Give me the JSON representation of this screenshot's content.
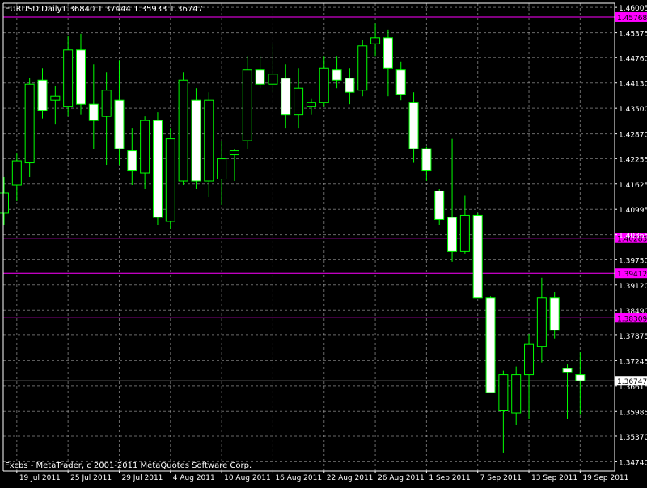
{
  "chart_data": {
    "type": "candlestick",
    "header": {
      "symbol_label": "EURUSD,Daily",
      "ohlc_text": "1.36840 1.37444 1.35933 1.36747"
    },
    "copyright": "Fxcbs - MetaTrader, c 2001-2011 MetaQuotes Software Corp.",
    "ylim": [
      1.34568,
      1.46128
    ],
    "y_ticks": [
      "1.46005",
      "1.45375",
      "1.44760",
      "1.44130",
      "1.43500",
      "1.42870",
      "1.42255",
      "1.41625",
      "1.40995",
      "1.40365",
      "1.39750",
      "1.39120",
      "1.38490",
      "1.37875",
      "1.37245",
      "1.36615",
      "1.35985",
      "1.35370",
      "1.34740"
    ],
    "x_ticks": [
      {
        "label": "19 Jul 2011",
        "bar": 1
      },
      {
        "label": "25 Jul 2011",
        "bar": 5
      },
      {
        "label": "29 Jul 2011",
        "bar": 9
      },
      {
        "label": "4 Aug 2011",
        "bar": 13
      },
      {
        "label": "10 Aug 2011",
        "bar": 17
      },
      {
        "label": "16 Aug 2011",
        "bar": 21
      },
      {
        "label": "22 Aug 2011",
        "bar": 25
      },
      {
        "label": "26 Aug 2011",
        "bar": 29
      },
      {
        "label": "1 Sep 2011",
        "bar": 33
      },
      {
        "label": "7 Sep 2011",
        "bar": 37
      },
      {
        "label": "13 Sep 2011",
        "bar": 41
      },
      {
        "label": "19 Sep 2011",
        "bar": 45
      }
    ],
    "candles": [
      {
        "o": 1.409,
        "h": 1.418,
        "l": 1.406,
        "c": 1.414
      },
      {
        "o": 1.416,
        "h": 1.424,
        "l": 1.412,
        "c": 1.422
      },
      {
        "o": 1.4215,
        "h": 1.4425,
        "l": 1.418,
        "c": 1.441
      },
      {
        "o": 1.442,
        "h": 1.445,
        "l": 1.4325,
        "c": 1.4345
      },
      {
        "o": 1.437,
        "h": 1.4405,
        "l": 1.431,
        "c": 1.438
      },
      {
        "o": 1.4355,
        "h": 1.453,
        "l": 1.433,
        "c": 1.4495
      },
      {
        "o": 1.4495,
        "h": 1.4535,
        "l": 1.4335,
        "c": 1.436
      },
      {
        "o": 1.436,
        "h": 1.446,
        "l": 1.425,
        "c": 1.432
      },
      {
        "o": 1.433,
        "h": 1.444,
        "l": 1.421,
        "c": 1.4395
      },
      {
        "o": 1.437,
        "h": 1.447,
        "l": 1.421,
        "c": 1.425
      },
      {
        "o": 1.4245,
        "h": 1.43,
        "l": 1.416,
        "c": 1.4195
      },
      {
        "o": 1.419,
        "h": 1.433,
        "l": 1.415,
        "c": 1.432
      },
      {
        "o": 1.432,
        "h": 1.434,
        "l": 1.406,
        "c": 1.408
      },
      {
        "o": 1.407,
        "h": 1.43,
        "l": 1.405,
        "c": 1.4275
      },
      {
        "o": 1.417,
        "h": 1.444,
        "l": 1.416,
        "c": 1.442
      },
      {
        "o": 1.437,
        "h": 1.44,
        "l": 1.415,
        "c": 1.417
      },
      {
        "o": 1.417,
        "h": 1.439,
        "l": 1.413,
        "c": 1.437
      },
      {
        "o": 1.4175,
        "h": 1.427,
        "l": 1.411,
        "c": 1.4225
      },
      {
        "o": 1.4235,
        "h": 1.425,
        "l": 1.417,
        "c": 1.4245
      },
      {
        "o": 1.427,
        "h": 1.448,
        "l": 1.425,
        "c": 1.4445
      },
      {
        "o": 1.4445,
        "h": 1.448,
        "l": 1.44,
        "c": 1.441
      },
      {
        "o": 1.441,
        "h": 1.451,
        "l": 1.439,
        "c": 1.4435
      },
      {
        "o": 1.4425,
        "h": 1.446,
        "l": 1.43,
        "c": 1.4335
      },
      {
        "o": 1.4335,
        "h": 1.445,
        "l": 1.43,
        "c": 1.44
      },
      {
        "o": 1.4355,
        "h": 1.4375,
        "l": 1.4335,
        "c": 1.4365
      },
      {
        "o": 1.4365,
        "h": 1.448,
        "l": 1.4355,
        "c": 1.445
      },
      {
        "o": 1.4445,
        "h": 1.448,
        "l": 1.44,
        "c": 1.442
      },
      {
        "o": 1.4425,
        "h": 1.445,
        "l": 1.436,
        "c": 1.439
      },
      {
        "o": 1.4395,
        "h": 1.452,
        "l": 1.438,
        "c": 1.4505
      },
      {
        "o": 1.451,
        "h": 1.456,
        "l": 1.448,
        "c": 1.4525
      },
      {
        "o": 1.4525,
        "h": 1.4545,
        "l": 1.438,
        "c": 1.445
      },
      {
        "o": 1.4445,
        "h": 1.4465,
        "l": 1.437,
        "c": 1.4385
      },
      {
        "o": 1.4365,
        "h": 1.439,
        "l": 1.4215,
        "c": 1.425
      },
      {
        "o": 1.425,
        "h": 1.4255,
        "l": 1.417,
        "c": 1.4195
      },
      {
        "o": 1.4145,
        "h": 1.415,
        "l": 1.406,
        "c": 1.4075
      },
      {
        "o": 1.408,
        "h": 1.4275,
        "l": 1.397,
        "c": 1.3995
      },
      {
        "o": 1.3995,
        "h": 1.4135,
        "l": 1.399,
        "c": 1.4085
      },
      {
        "o": 1.4085,
        "h": 1.409,
        "l": 1.391,
        "c": 1.388
      },
      {
        "o": 1.388,
        "h": 1.3885,
        "l": 1.366,
        "c": 1.3645
      },
      {
        "o": 1.36,
        "h": 1.37,
        "l": 1.3495,
        "c": 1.369
      },
      {
        "o": 1.3595,
        "h": 1.371,
        "l": 1.3565,
        "c": 1.369
      },
      {
        "o": 1.369,
        "h": 1.379,
        "l": 1.358,
        "c": 1.3765
      },
      {
        "o": 1.376,
        "h": 1.393,
        "l": 1.372,
        "c": 1.388
      },
      {
        "o": 1.388,
        "h": 1.3895,
        "l": 1.378,
        "c": 1.38
      },
      {
        "o": 1.3705,
        "h": 1.3715,
        "l": 1.358,
        "c": 1.3695
      },
      {
        "o": 1.369,
        "h": 1.3745,
        "l": 1.359,
        "c": 1.36747
      }
    ],
    "hlines": [
      {
        "price": 1.45768,
        "label": "1.45768"
      },
      {
        "price": 1.40283,
        "label": "1.40283"
      },
      {
        "price": 1.39412,
        "label": "1.39412"
      },
      {
        "price": 1.38309,
        "label": "1.38309"
      }
    ],
    "bid_line": {
      "price": 1.36747,
      "label": "1.36747"
    },
    "colors": {
      "background": "#000000",
      "grid": "#c0c0c0",
      "foreground": "#ffffff",
      "bull_body": "#000000",
      "bear_body": "#ffffff",
      "wick": "#00ff00",
      "hline": "#ff00ff",
      "hline_label_text": "#000000",
      "bid_label_bg": "#ffffff"
    }
  }
}
